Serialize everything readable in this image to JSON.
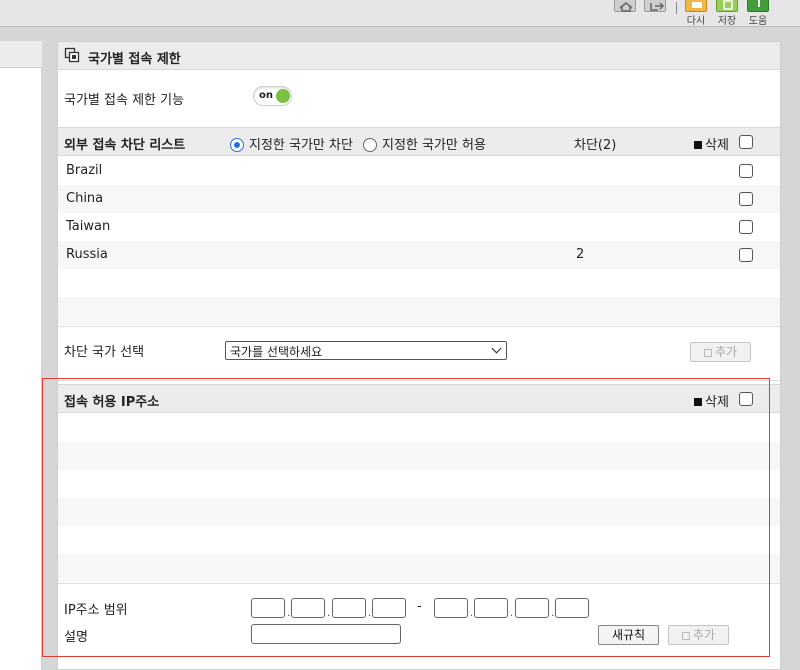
{
  "toolbar": {
    "buttons": [
      {
        "icon": "home-icon",
        "label": ""
      },
      {
        "icon": "logout-icon",
        "label": ""
      },
      {
        "icon": "reset-icon",
        "label": "다시"
      },
      {
        "icon": "save-icon",
        "label": "저장"
      },
      {
        "icon": "help-icon",
        "label": "도움"
      }
    ]
  },
  "section": {
    "title": "국가별 접속 제한",
    "feature_label": "국가별 접속 제한 기능",
    "toggle_text": "on"
  },
  "block_list": {
    "title": "외부 접속 차단 리스트",
    "radio_block_only": "지정한 국가만 차단",
    "radio_allow_only": "지정한 국가만 허용",
    "count_header": "차단(2)",
    "delete_label": "삭제",
    "rows": [
      {
        "country": "Brazil",
        "count": ""
      },
      {
        "country": "China",
        "count": ""
      },
      {
        "country": "Taiwan",
        "count": ""
      },
      {
        "country": "Russia",
        "count": "2"
      }
    ]
  },
  "country_select": {
    "label": "차단 국가 선택",
    "placeholder": "국가를 선택하세요",
    "add_button": "추가"
  },
  "allow_ip": {
    "title": "접속 허용 IP주소",
    "delete_label": "삭제",
    "range_label": "IP주소 범위",
    "range_dash": "-",
    "desc_label": "설명",
    "new_rule_button": "새규칙",
    "add_button": "추가"
  },
  "colors": {
    "accent_green": "#7ac143",
    "radio_blue": "#2a6fdb",
    "highlight_red": "#e53935"
  }
}
